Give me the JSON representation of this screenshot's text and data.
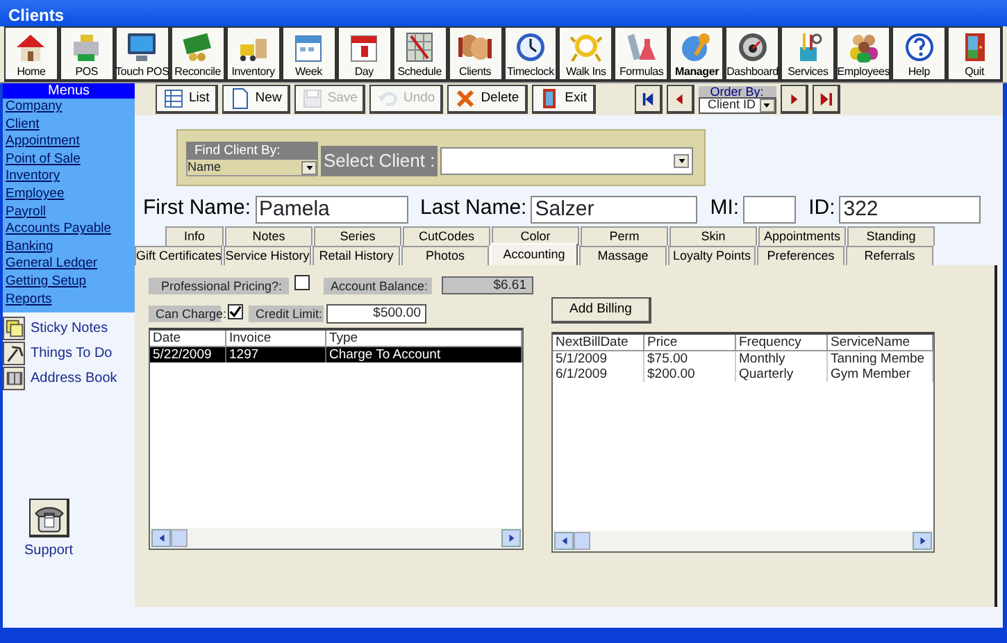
{
  "window": {
    "title": "Clients"
  },
  "toolbar": [
    {
      "label": "Home",
      "bold": false
    },
    {
      "label": "POS",
      "bold": false
    },
    {
      "label": "Touch POS",
      "bold": false
    },
    {
      "label": "Reconcile",
      "bold": false
    },
    {
      "label": "Inventory",
      "bold": false
    },
    {
      "label": "Week",
      "bold": false
    },
    {
      "label": "Day",
      "bold": false
    },
    {
      "label": "Schedule",
      "bold": false
    },
    {
      "label": "Clients",
      "bold": false
    },
    {
      "label": "Timeclock",
      "bold": false
    },
    {
      "label": "Walk Ins",
      "bold": false
    },
    {
      "label": "Formulas",
      "bold": false
    },
    {
      "label": "Manager",
      "bold": true
    },
    {
      "label": "Dashboard",
      "bold": false
    },
    {
      "label": "Services",
      "bold": false
    },
    {
      "label": "Employees",
      "bold": false
    },
    {
      "label": "Help",
      "bold": false
    },
    {
      "label": "Quit",
      "bold": false
    }
  ],
  "menus": {
    "title": "Menus",
    "items": [
      "Company",
      "Client",
      "Appointment",
      "Point of Sale",
      "Inventory",
      "Employee",
      "Payroll",
      "Accounts Payable",
      "Banking",
      "General Ledger",
      "Getting Setup",
      "Reports"
    ]
  },
  "shortcuts": [
    "Sticky Notes",
    "Things To Do",
    "Address Book"
  ],
  "support": "Support",
  "record_toolbar": [
    {
      "label": "List",
      "disabled": false
    },
    {
      "label": "New",
      "disabled": false
    },
    {
      "label": "Save",
      "disabled": true
    },
    {
      "label": "Undo",
      "disabled": true
    },
    {
      "label": "Delete",
      "disabled": false
    },
    {
      "label": "Exit",
      "disabled": false
    }
  ],
  "order_by": {
    "label": "Order By:",
    "value": "Client ID"
  },
  "find": {
    "label": "Find Client By:",
    "value": "Name",
    "select_label": "Select Client :"
  },
  "client_fields": [
    {
      "label": "First Name:",
      "value": "Pamela"
    },
    {
      "label": "Last Name:",
      "value": "Salzer"
    },
    {
      "label": "MI:"
    },
    {
      "label": "ID:",
      "value": "322"
    }
  ],
  "tab_rows": [
    [
      {
        "label": "Info",
        "selected": false
      },
      {
        "label": "Notes",
        "selected": false
      },
      {
        "label": "Series",
        "selected": false
      },
      {
        "label": "CutCodes",
        "selected": false
      },
      {
        "label": "Color",
        "selected": false
      },
      {
        "label": "Perm",
        "selected": false
      },
      {
        "label": "Skin",
        "selected": false
      },
      {
        "label": "Appointments",
        "selected": false
      },
      {
        "label": "Standing",
        "selected": false
      }
    ],
    [
      {
        "label": "Gift Certificates",
        "selected": false
      },
      {
        "label": "Service History",
        "selected": false
      },
      {
        "label": "Retail History",
        "selected": false
      },
      {
        "label": "Photos",
        "selected": false
      },
      {
        "label": "Accounting",
        "selected": true
      },
      {
        "label": "Massage",
        "selected": false
      },
      {
        "label": "Loyalty Points",
        "selected": false
      },
      {
        "label": "Preferences",
        "selected": false
      },
      {
        "label": "Referrals",
        "selected": false
      }
    ]
  ],
  "accounting": {
    "professional_pricing": {
      "label": "Professional Pricing?:",
      "checked": false
    },
    "account_balance": {
      "label": "Account Balance:",
      "value": "$6.61"
    },
    "can_charge": {
      "label": "Can Charge:",
      "checked": true
    },
    "credit_limit": {
      "label": "Credit Limit:",
      "value": "$500.00"
    },
    "add_billing": "Add Billing"
  },
  "transactions": {
    "columns": [
      "Date",
      "Invoice",
      "Type"
    ],
    "rows": [
      {
        "cells": [
          "5/22/2009",
          "1297",
          "Charge To Account"
        ],
        "selected": true
      }
    ]
  },
  "billing": {
    "columns": [
      "NextBillDate",
      "Price",
      "Frequency",
      "ServiceName"
    ],
    "rows": [
      {
        "cells": [
          "5/1/2009",
          "$75.00",
          "Monthly",
          "Tanning Membe"
        ],
        "selected": false
      },
      {
        "cells": [
          "6/1/2009",
          "$200.00",
          "Quarterly",
          "Gym Member"
        ],
        "selected": false
      }
    ]
  }
}
